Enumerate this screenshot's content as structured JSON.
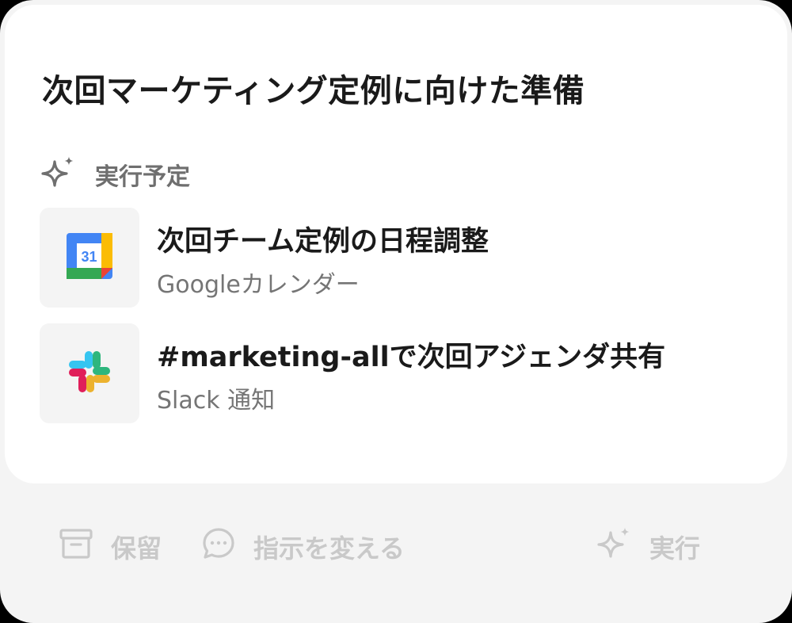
{
  "card": {
    "title": "次回マーケティング定例に向けた準備",
    "section_label": "実行予定",
    "section_icon": "sparkle-icon",
    "tasks": [
      {
        "title": "次回チーム定例の日程調整",
        "subtitle": "Googleカレンダー",
        "icon": "google-calendar-icon",
        "calendar_day": "31"
      },
      {
        "title": "#marketing-allで次回アジェンダ共有",
        "subtitle": "Slack 通知",
        "icon": "slack-icon"
      }
    ]
  },
  "actions": {
    "hold": {
      "label": "保留",
      "icon": "archive-box-icon"
    },
    "change_instructions": {
      "label": "指示を変える",
      "icon": "chat-bubble-icon"
    },
    "execute": {
      "label": "実行",
      "icon": "sparkle-icon"
    }
  },
  "colors": {
    "panel_bg": "#f4f4f4",
    "card_bg": "#ffffff",
    "title_text": "#1a1a1a",
    "secondary_text": "#757575",
    "disabled_action": "#c9c9c9",
    "gcal_blue": "#4285f4",
    "gcal_green": "#34a853",
    "gcal_yellow": "#fbbc04",
    "gcal_red": "#ea4335",
    "slack_cyan": "#36c5f0",
    "slack_green": "#2eb67d",
    "slack_yellow": "#ecb22e",
    "slack_red": "#e01e5a"
  }
}
